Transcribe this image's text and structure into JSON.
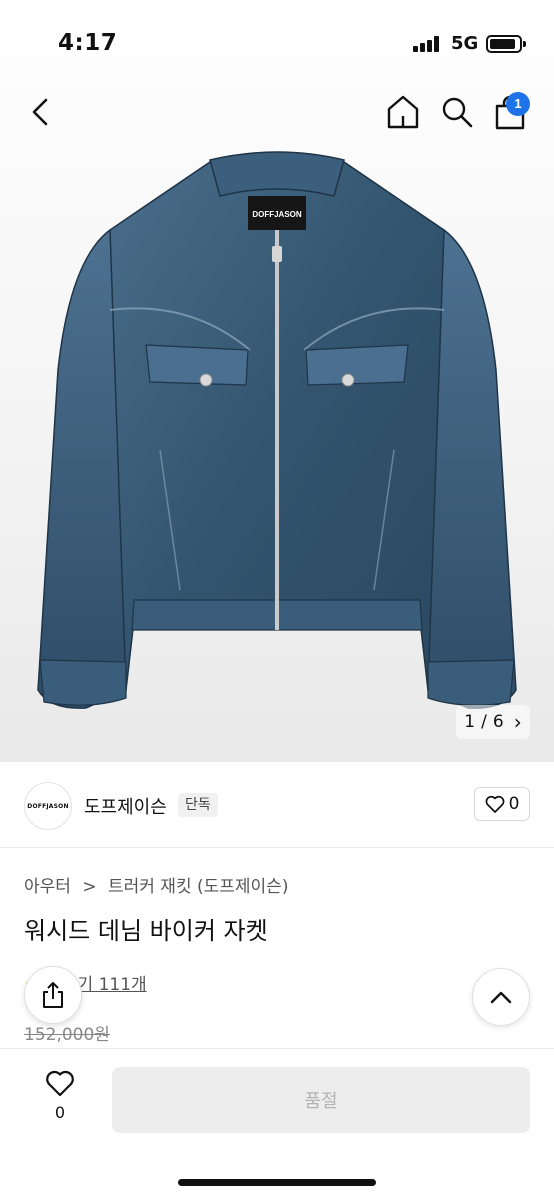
{
  "status_bar": {
    "time": "4:17",
    "network": "5G"
  },
  "header": {
    "cart_count": "1"
  },
  "gallery": {
    "jacket_logo": "DOFFJASON",
    "current": "1",
    "separator": "/",
    "total": "6",
    "next": "›"
  },
  "brand": {
    "logo_text": "DOFFJASON",
    "name": "도프제이슨",
    "tag": "단독",
    "like_count": "0"
  },
  "product": {
    "breadcrumb": [
      "아우터",
      "트러커 재킷 (도프제이슨)"
    ],
    "breadcrumb_sep": ">",
    "title": "워시드 데님 바이커 자켓",
    "rating_stars": "★★",
    "review_label": "후기 111개",
    "original_price": "152,000원"
  },
  "bottom": {
    "wish_count": "0",
    "buy_button": "품절"
  },
  "colors": {
    "accent": "#1e73e8",
    "denim_dark": "#2c4a63",
    "denim_mid": "#3f6483",
    "star": "#f5b400",
    "disabled_bg": "#ededed",
    "disabled_text": "#b3b3b3"
  }
}
